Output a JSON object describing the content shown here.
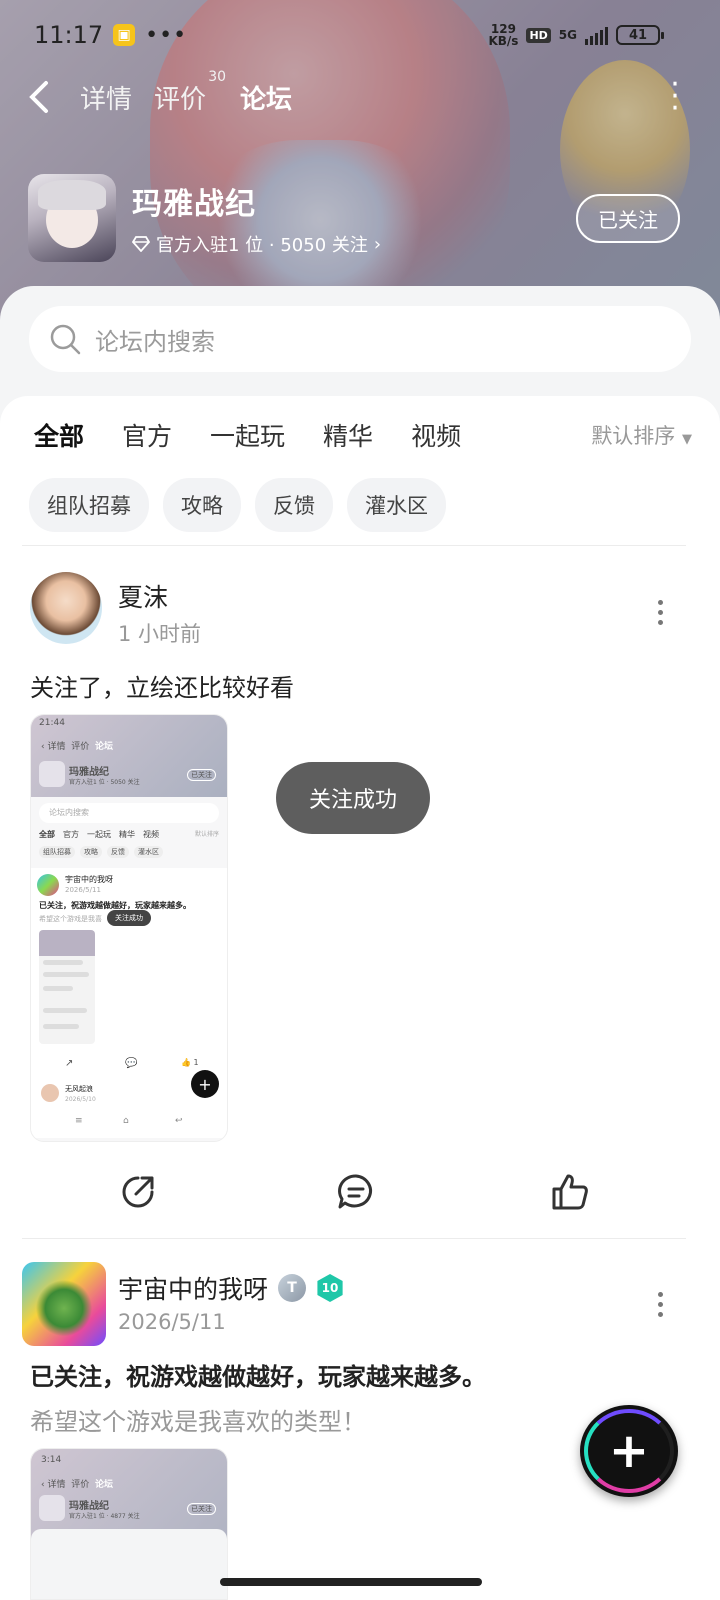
{
  "status_bar": {
    "time": "11:17",
    "net_speed_value": "129",
    "net_speed_unit": "KB/s",
    "hd": "HD",
    "network": "5G",
    "battery": "41"
  },
  "nav": {
    "tabs": [
      {
        "label": "详情"
      },
      {
        "label": "评价",
        "count": "30"
      },
      {
        "label": "论坛"
      }
    ],
    "active_tab": "论坛"
  },
  "game": {
    "name": "玛雅战纪",
    "meta": "官方入驻1 位 · 5050 关注",
    "follow_label": "已关注"
  },
  "search": {
    "placeholder": "论坛内搜索"
  },
  "filter_tabs": {
    "items": [
      "全部",
      "官方",
      "一起玩",
      "精华",
      "视频"
    ],
    "active": "全部",
    "sort_label": "默认排序"
  },
  "chips": [
    "组队招募",
    "攻略",
    "反馈",
    "灌水区"
  ],
  "posts": [
    {
      "author": "夏沫",
      "time": "1 小时前",
      "text": "关注了，立绘还比较好看",
      "toast": "关注成功"
    },
    {
      "author": "宇宙中的我呀",
      "level": "10",
      "badge": "T",
      "time": "2026/5/11",
      "title": "已关注，祝游戏越做越好，玩家越来越多。",
      "subtitle": "希望这个游戏是我喜欢的类型！"
    }
  ],
  "screenshot_thumb": {
    "time": "21:44",
    "tabs": [
      "详情",
      "评价",
      "论坛"
    ],
    "game": "玛雅战纪",
    "meta": "官方入驻1 位 · 5050 关注",
    "follow": "已关注",
    "search": "论坛内搜索",
    "filter": [
      "全部",
      "官方",
      "一起玩",
      "精华",
      "视频",
      "默认排序"
    ],
    "chips": [
      "组队招募",
      "攻略",
      "反馈",
      "灌水区"
    ],
    "post_author": "宇宙中的我呀",
    "post_date": "2026/5/11",
    "post_text": "已关注，祝游戏越做越好，玩家越来越多。",
    "post_sub": "希望这个游戏是我喜",
    "toast": "关注成功",
    "like": "1",
    "next_author": "无风起浪",
    "next_date": "2026/5/10"
  },
  "screenshot_thumb2": {
    "time": "3:14",
    "tabs": [
      "详情",
      "评价",
      "论坛"
    ],
    "game": "玛雅战纪",
    "meta": "官方入驻1 位 · 4877 关注",
    "follow": "已关注"
  },
  "icons": [
    "back-icon",
    "more-icon",
    "diamond-icon",
    "search-icon",
    "share-icon",
    "comment-icon",
    "like-icon",
    "plus-icon"
  ],
  "colors": {
    "accent": "#24d3b6"
  }
}
